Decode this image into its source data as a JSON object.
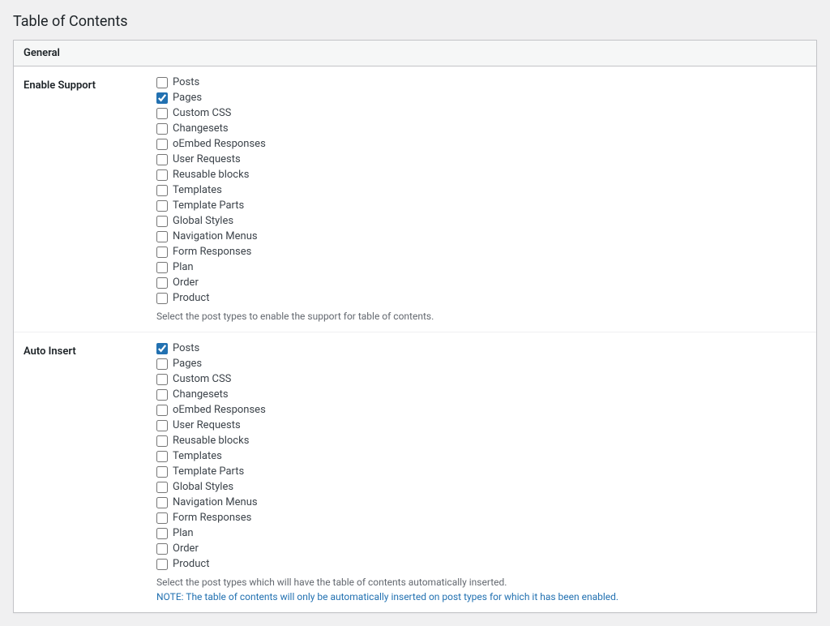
{
  "page": {
    "title": "Table of Contents"
  },
  "card": {
    "section_label": "General"
  },
  "enable_support": {
    "label": "Enable Support",
    "checkboxes": [
      {
        "id": "es_posts",
        "label": "Posts",
        "checked": false
      },
      {
        "id": "es_pages",
        "label": "Pages",
        "checked": true
      },
      {
        "id": "es_custom_css",
        "label": "Custom CSS",
        "checked": false
      },
      {
        "id": "es_changesets",
        "label": "Changesets",
        "checked": false
      },
      {
        "id": "es_oembed",
        "label": "oEmbed Responses",
        "checked": false
      },
      {
        "id": "es_user_requests",
        "label": "User Requests",
        "checked": false
      },
      {
        "id": "es_reusable",
        "label": "Reusable blocks",
        "checked": false
      },
      {
        "id": "es_templates",
        "label": "Templates",
        "checked": false
      },
      {
        "id": "es_template_parts",
        "label": "Template Parts",
        "checked": false
      },
      {
        "id": "es_global_styles",
        "label": "Global Styles",
        "checked": false
      },
      {
        "id": "es_nav_menus",
        "label": "Navigation Menus",
        "checked": false
      },
      {
        "id": "es_form_responses",
        "label": "Form Responses",
        "checked": false
      },
      {
        "id": "es_plan",
        "label": "Plan",
        "checked": false
      },
      {
        "id": "es_order",
        "label": "Order",
        "checked": false
      },
      {
        "id": "es_product",
        "label": "Product",
        "checked": false
      }
    ],
    "help_text": "Select the post types to enable the support for table of contents."
  },
  "auto_insert": {
    "label": "Auto Insert",
    "checkboxes": [
      {
        "id": "ai_posts",
        "label": "Posts",
        "checked": true
      },
      {
        "id": "ai_pages",
        "label": "Pages",
        "checked": false
      },
      {
        "id": "ai_custom_css",
        "label": "Custom CSS",
        "checked": false
      },
      {
        "id": "ai_changesets",
        "label": "Changesets",
        "checked": false
      },
      {
        "id": "ai_oembed",
        "label": "oEmbed Responses",
        "checked": false
      },
      {
        "id": "ai_user_requests",
        "label": "User Requests",
        "checked": false
      },
      {
        "id": "ai_reusable",
        "label": "Reusable blocks",
        "checked": false
      },
      {
        "id": "ai_templates",
        "label": "Templates",
        "checked": false
      },
      {
        "id": "ai_template_parts",
        "label": "Template Parts",
        "checked": false
      },
      {
        "id": "ai_global_styles",
        "label": "Global Styles",
        "checked": false
      },
      {
        "id": "ai_nav_menus",
        "label": "Navigation Menus",
        "checked": false
      },
      {
        "id": "ai_form_responses",
        "label": "Form Responses",
        "checked": false
      },
      {
        "id": "ai_plan",
        "label": "Plan",
        "checked": false
      },
      {
        "id": "ai_order",
        "label": "Order",
        "checked": false
      },
      {
        "id": "ai_product",
        "label": "Product",
        "checked": false
      }
    ],
    "help_text": "Select the post types which will have the table of contents automatically inserted.",
    "help_text_note": "NOTE: The table of contents will only be automatically inserted on post types for which it has been enabled."
  }
}
